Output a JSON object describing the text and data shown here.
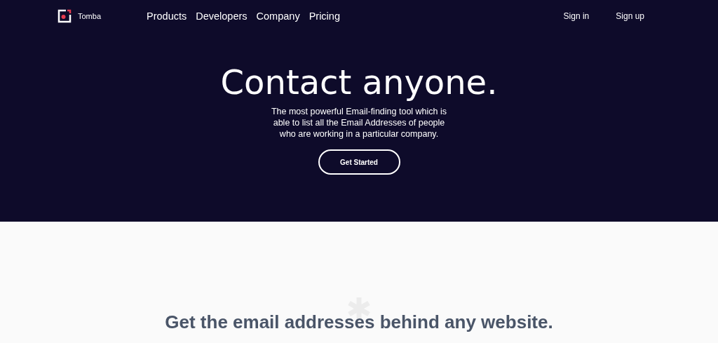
{
  "brand": {
    "name": "Tomba"
  },
  "nav": [
    "Products",
    "Developers",
    "Company",
    "Pricing"
  ],
  "auth": [
    "Sign in",
    "Sign up"
  ],
  "hero": {
    "title": "Contact anyone.",
    "description": "The most powerful Email-finding tool which is able to list all the Email Addresses of people who are working in a particular company.",
    "button": "Get Started"
  },
  "section": {
    "heading": "Get the email addresses behind any website."
  }
}
